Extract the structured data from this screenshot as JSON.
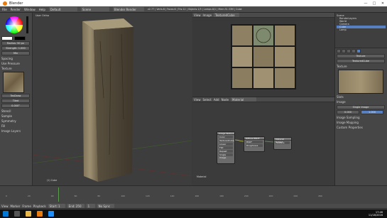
{
  "window": {
    "title": "Blender",
    "minimize": "—",
    "maximize": "□",
    "close": "✕"
  },
  "menubar": {
    "items": [
      "File",
      "Render",
      "Window",
      "Help"
    ],
    "layout": "Default",
    "engine": "Blender Render",
    "scene": "Scene",
    "stats": "v2.77 | Verts:8 | Faces:6 | Tris:12 | Objects:1/3 | Lamps:0/1 | Mem:31.33M | Cube"
  },
  "left_panel": {
    "color_value": "0.000",
    "radius": "Radius: 50 px",
    "strength": "Strength: 1.000",
    "blend": "Mix",
    "options": [
      "Spacing",
      "Use Pressure"
    ],
    "texture_section": "Texture",
    "mapping": "Tiled",
    "stencil": "Stencil",
    "angle": "0.000°",
    "sample": "Sample",
    "symmetry": "Symmetry",
    "fill": "Fill",
    "brush_name": "TexDraw",
    "image_layers": "Image Layers"
  },
  "viewport": {
    "label": "User Ortho",
    "object_label": "(1) Cube",
    "header": [
      "View",
      "Select",
      "Object",
      "Texture Paint"
    ]
  },
  "image_editor": {
    "header": [
      "View",
      "Image"
    ],
    "image_name": "TexturedCube"
  },
  "node_editor": {
    "header": [
      "View",
      "Select",
      "Add",
      "Node"
    ],
    "material": "Material",
    "label": "Material",
    "nodes": [
      {
        "title": "Image Texture",
        "rows": [
          "Color",
          "Alpha",
          "TexturedCube",
          "Linear",
          "Flat",
          "Repeat",
          "Single Image",
          "Vector"
        ]
      },
      {
        "title": "Diffuse BSDF",
        "rows": [
          "BSDF",
          "Color",
          "Roughness",
          "Normal"
        ]
      },
      {
        "title": "Material Output",
        "rows": [
          "Surface",
          "Volume",
          "Displacement"
        ]
      }
    ]
  },
  "right_panel": {
    "outliner": [
      "Scene",
      "RenderLayers",
      "World",
      "Camera",
      "Cube",
      "Lamp"
    ],
    "search_placeholder": "",
    "sections": [
      "Slots",
      "Painting",
      "Texture",
      "Tiling",
      "Brush",
      "Strokes",
      "Curve",
      "Options",
      "Custom Properties",
      "Image Sampling",
      "Image Mapping",
      "Cyclic"
    ],
    "texture_name": "Texture",
    "image_name": "TexturedCube",
    "source": "Single Image",
    "image_label": "Image",
    "prop_values": [
      "0.000",
      "1.000",
      "0.500"
    ]
  },
  "timeline": {
    "header": [
      "View",
      "Marker",
      "Frame",
      "Playback"
    ],
    "start": "Start: 1",
    "end": "End: 250",
    "current": "1",
    "sync": "No Sync",
    "ticks": [
      "0",
      "20",
      "40",
      "60",
      "80",
      "100",
      "120",
      "140",
      "160",
      "180",
      "200",
      "220",
      "240",
      "260"
    ]
  },
  "taskbar": {
    "time": "17:46",
    "date": "11/18/2016"
  },
  "colors": {
    "accent": "#5680c2",
    "node_header": "#7a7a7a",
    "wood": "#8a7a5c"
  }
}
